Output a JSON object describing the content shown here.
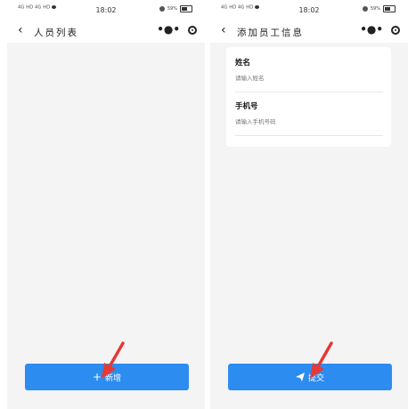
{
  "left_screen": {
    "status": {
      "carrier": "4G HD 4G HD",
      "time": "18:02",
      "battery": "59%"
    },
    "nav": {
      "back_icon": "chevron-left-icon",
      "title": "人员列表",
      "more": "•●•"
    },
    "add_button": {
      "icon": "plus-icon",
      "label": "新增"
    }
  },
  "right_screen": {
    "status": {
      "carrier": "4G HD 4G HD",
      "time": "18:02",
      "battery": "59%"
    },
    "nav": {
      "back_icon": "chevron-left-icon",
      "title": "添加员工信息",
      "more": "•●•"
    },
    "form": {
      "name_label": "姓名",
      "name_placeholder": "请输入姓名",
      "phone_label": "手机号",
      "phone_placeholder": "请输入手机号码"
    },
    "submit_button": {
      "icon": "paper-plane-icon",
      "label": "提交"
    }
  },
  "colors": {
    "primary": "#2d8cf0",
    "annotation_arrow": "#e53935",
    "background": "#f4f4f5"
  }
}
